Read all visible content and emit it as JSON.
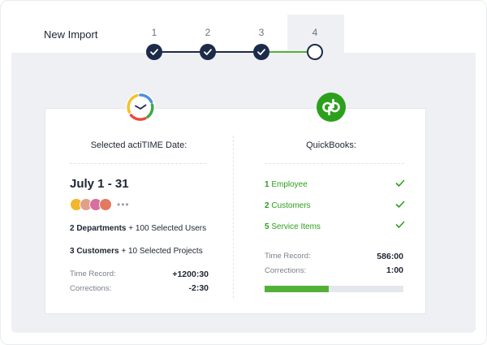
{
  "header": {
    "title": "New Import"
  },
  "stepper": {
    "steps": [
      {
        "number": "1",
        "state": "done"
      },
      {
        "number": "2",
        "state": "done"
      },
      {
        "number": "3",
        "state": "done"
      },
      {
        "number": "4",
        "state": "current"
      }
    ]
  },
  "left": {
    "heading": "Selected actiTIME Date:",
    "date_range": "July 1 - 31",
    "more": "•••",
    "departments_count": "2 Departments",
    "departments_rest": " + 100 Selected Users",
    "customers_count": "3 Customers",
    "customers_rest": " + 10 Selected Projects",
    "time_record_label": "Time Record:",
    "time_record_value": "+1200:30",
    "corrections_label": "Corrections:",
    "corrections_value": "-2:30"
  },
  "right": {
    "heading": "QuickBooks:",
    "items": [
      {
        "count": "1",
        "label": " Employee"
      },
      {
        "count": "2",
        "label": " Customers"
      },
      {
        "count": "5",
        "label": " Service Items"
      }
    ],
    "time_record_label": "Time Record:",
    "time_record_value": "586:00",
    "corrections_label": "Corrections:",
    "corrections_value": "1:00",
    "progress_fraction": 0.46
  },
  "colors": {
    "navy": "#1c2b48",
    "green": "#2ca01c",
    "progress": "#53b138"
  },
  "icons": {
    "acti_logo": "actitime-clock-icon",
    "qb_logo": "quickbooks-logo-icon",
    "check": "check-icon"
  }
}
